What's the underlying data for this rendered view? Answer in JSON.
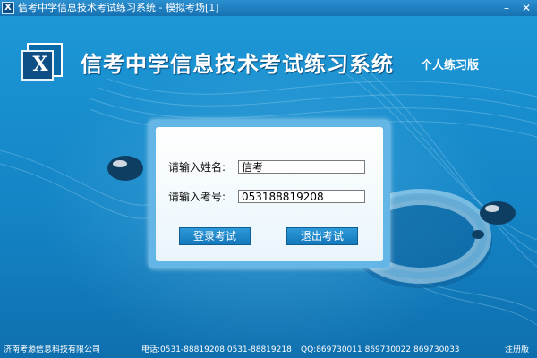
{
  "window": {
    "title": "信考中学信息技术考试练习系统 - 模拟考场[1]",
    "app_icon": "x-logo-icon",
    "minimize_label": "–",
    "close_label": "✕"
  },
  "header": {
    "logo_letter": "X",
    "title": "信考中学信息技术考试练习系统",
    "edition": "个人练习版"
  },
  "login": {
    "name_label": "请输入姓名:",
    "name_value": "信考",
    "id_label": "请输入考号:",
    "id_value": "053188819208",
    "start_button": "登录考试",
    "exit_button": "退出考试"
  },
  "footer": {
    "company": "济南考源信息科技有限公司",
    "phone": "电话:0531-88819208   0531-88819218",
    "qq": "QQ:869730011   869730022   869730033",
    "register": "注册版"
  },
  "colors": {
    "background": "#1487c8",
    "button": "#1e88c9",
    "panel_border": "#63b6e6"
  }
}
